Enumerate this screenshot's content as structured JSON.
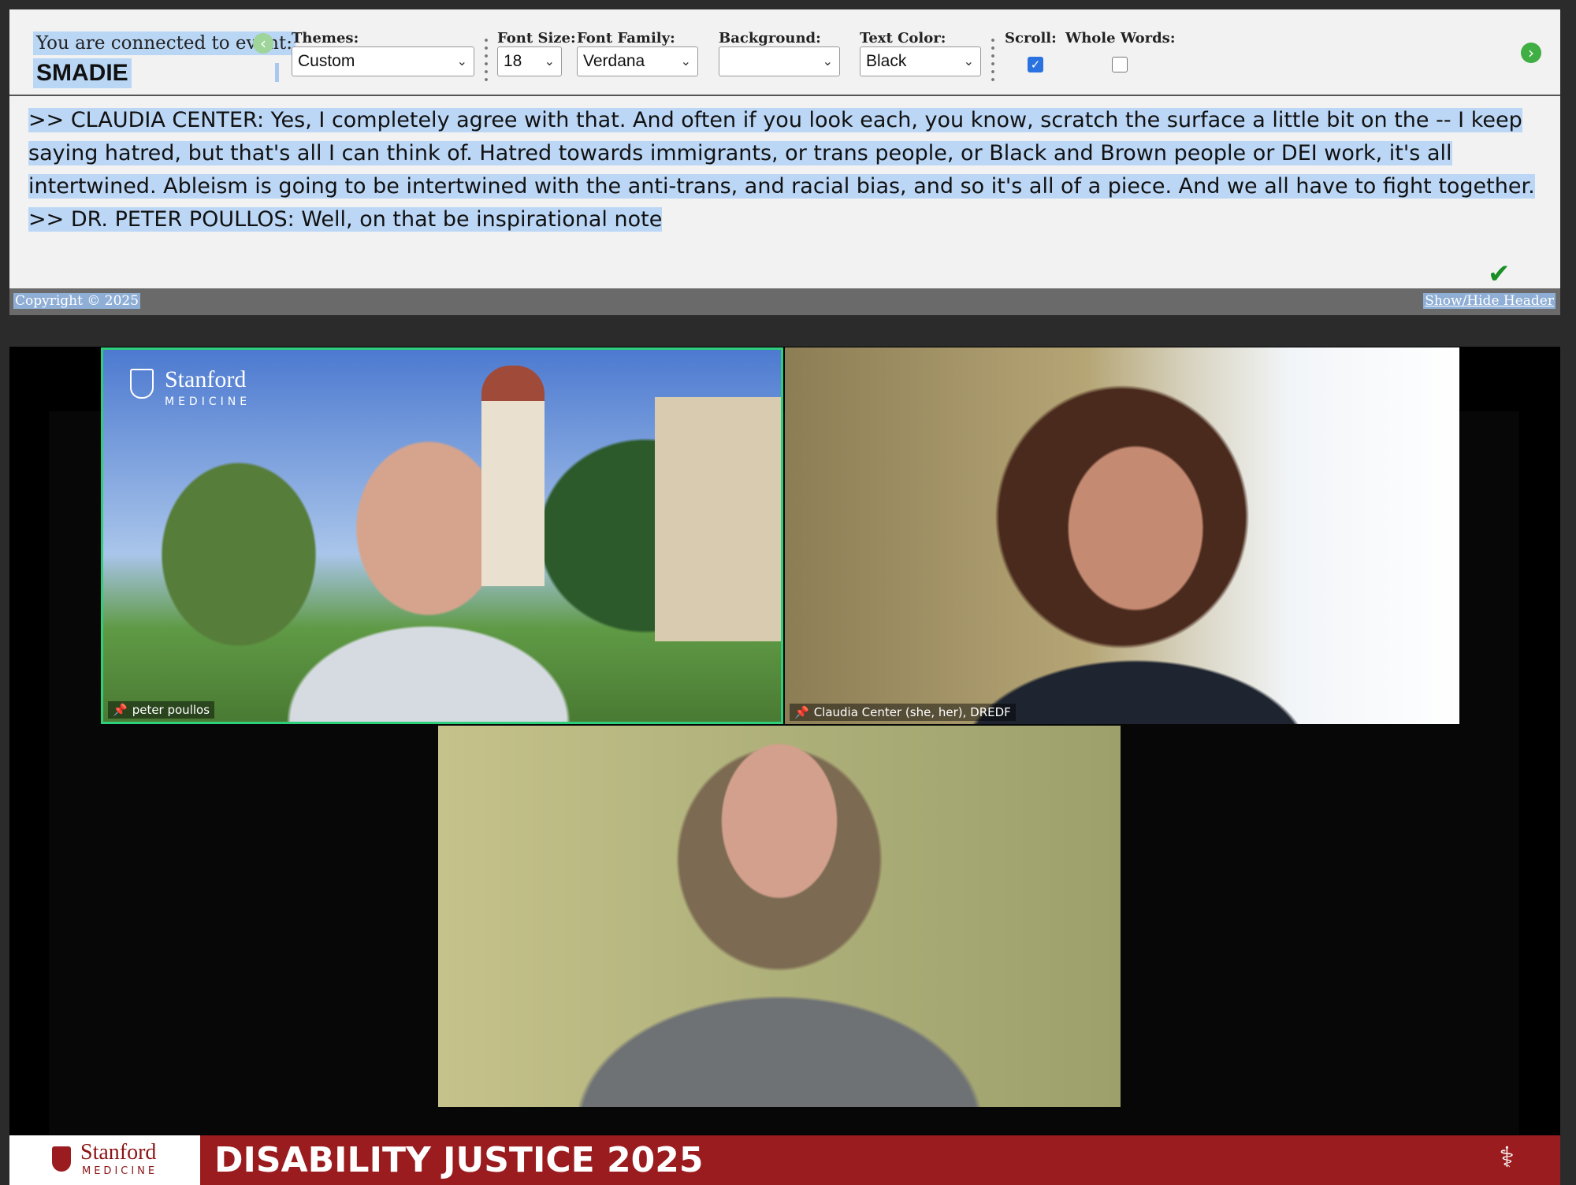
{
  "header": {
    "connected_label": "You are connected to event:",
    "event_name": "SMADIE",
    "themes": {
      "label": "Themes:",
      "value": "Custom"
    },
    "font_size": {
      "label": "Font Size:",
      "value": "18"
    },
    "font_family": {
      "label": "Font Family:",
      "value": "Verdana"
    },
    "background": {
      "label": "Background:",
      "value": ""
    },
    "text_color": {
      "label": "Text Color:",
      "value": "Black"
    },
    "scroll": {
      "label": "Scroll:",
      "checked": true
    },
    "whole_words": {
      "label": "Whole Words:",
      "checked": false
    },
    "icons": {
      "back": "chevron-left-icon",
      "forward": "chevron-right-icon"
    },
    "accent_color": "#3fae43"
  },
  "transcript": {
    "paragraphs": [
      ">> CLAUDIA CENTER:  Yes, I completely agree with that.  And often if you look each, you know, scratch the surface a little bit on the -- I keep saying hatred, but that's all I can think of.  Hatred towards immigrants, or trans people, or Black and Brown people or DEI work, it's all intertwined.  Ableism is going to be intertwined with the anti-trans, and racial bias, and so it's all of a piece.  And we all have to fight together.",
      ">> DR. PETER POULLOS:  Well, on that be inspirational note"
    ],
    "highlight_color": "#bcd7f6"
  },
  "footer": {
    "copyright": "Copyright © 2025",
    "show_hide_link": "Show/Hide Header"
  },
  "video": {
    "participants": [
      {
        "name": "peter poullos"
      },
      {
        "name": "Claudia Center (she, her), DREDF"
      },
      {
        "name": ""
      }
    ],
    "tile_logo": {
      "word": "Stanford",
      "sub": "MEDICINE"
    },
    "active_speaker_color": "#2ecf7a"
  },
  "banner": {
    "logo_word": "Stanford",
    "logo_sub": "MEDICINE",
    "title": "DISABILITY JUSTICE 2025",
    "color": "#9b1c1f",
    "icon": "stethoscope-icon"
  }
}
